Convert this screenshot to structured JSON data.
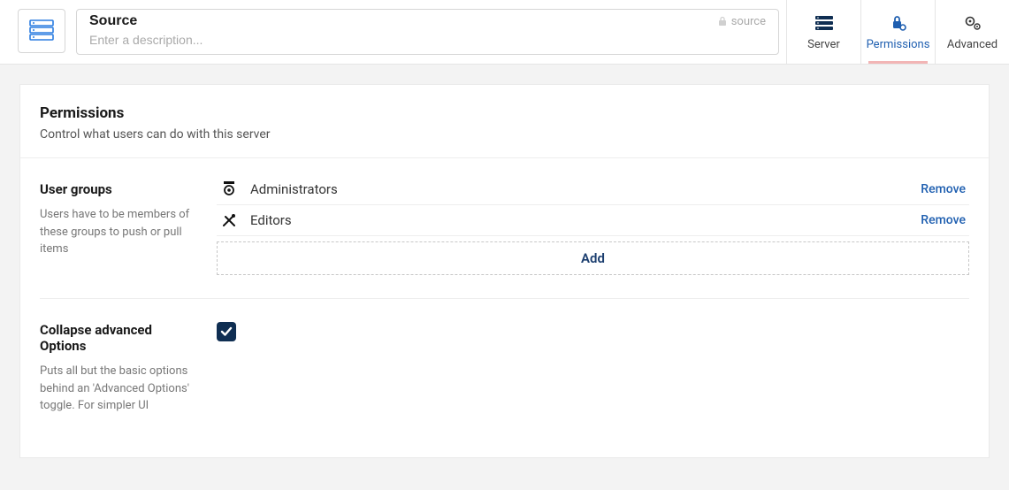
{
  "header": {
    "title_value": "Source",
    "description_value": "",
    "description_placeholder": "Enter a description...",
    "slug_label": "source"
  },
  "tabs": {
    "server": "Server",
    "permissions": "Permissions",
    "advanced": "Advanced"
  },
  "panel": {
    "title": "Permissions",
    "subtitle": "Control what users can do with this server"
  },
  "user_groups": {
    "heading": "User groups",
    "description": "Users have to be members of these groups to push or pull items",
    "items": [
      {
        "name": "Administrators",
        "remove": "Remove"
      },
      {
        "name": "Editors",
        "remove": "Remove"
      }
    ],
    "add_label": "Add"
  },
  "collapse": {
    "heading": "Collapse advanced Options",
    "description": "Puts all but the basic options behind an 'Advanced Options' toggle. For simpler UI",
    "checked": true
  }
}
